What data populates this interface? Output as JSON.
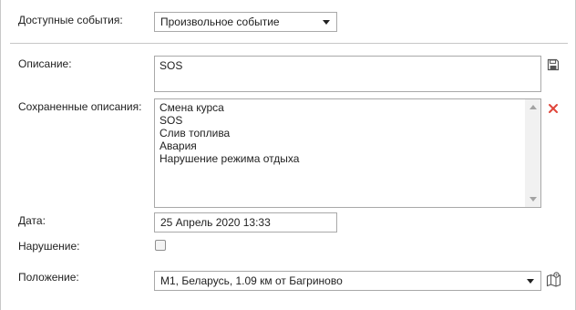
{
  "form": {
    "available_events": {
      "label": "Доступные события:",
      "selected": "Произвольное событие"
    },
    "description": {
      "label": "Описание:",
      "value": "SOS"
    },
    "saved_descriptions": {
      "label": "Сохраненные описания:",
      "items": [
        "Смена курса",
        "SOS",
        "Слив топлива",
        "Авария",
        "Нарушение режима отдыха"
      ]
    },
    "date": {
      "label": "Дата:",
      "value": "25 Апрель 2020 13:33"
    },
    "violation": {
      "label": "Нарушение:",
      "checked": false
    },
    "position": {
      "label": "Положение:",
      "selected": "M1, Беларусь, 1.09 км от Багриново"
    }
  },
  "icons": {
    "save": "floppy-disk-icon",
    "delete": "red-x-icon",
    "map": "map-icon"
  },
  "colors": {
    "delete_icon": "#e0453a",
    "border": "#a9a9a9",
    "divider": "#c7c7c7"
  }
}
